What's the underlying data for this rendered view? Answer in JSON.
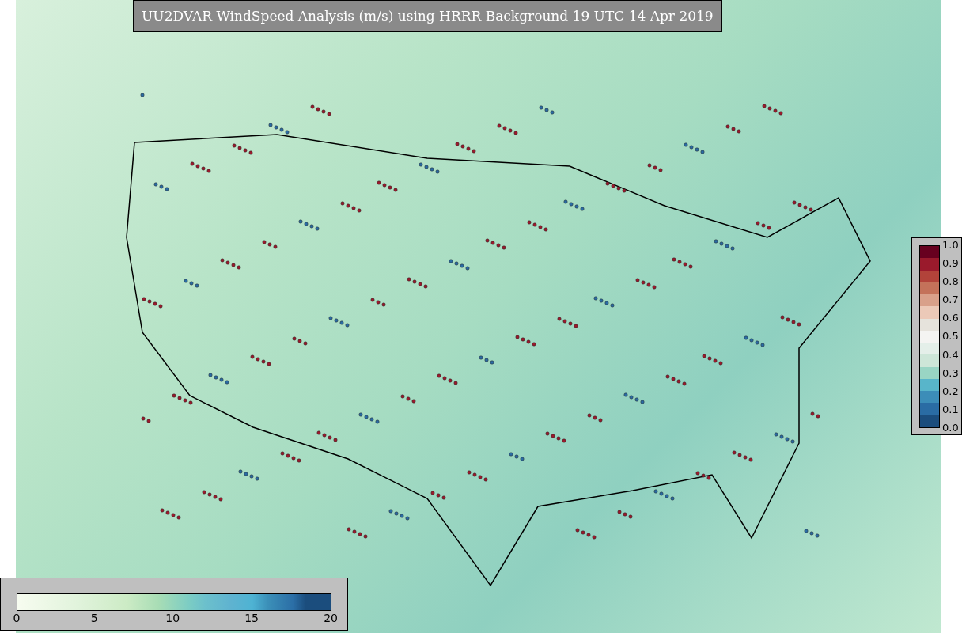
{
  "title": "UU2DVAR WindSpeed Analysis (m/s) using HRRR Background 19 UTC 14 Apr 2019",
  "right_colorbar": {
    "ticks": [
      "1.0",
      "0.9",
      "0.8",
      "0.7",
      "0.6",
      "0.5",
      "0.4",
      "0.3",
      "0.2",
      "0.1",
      "0.0"
    ]
  },
  "bottom_colorbar": {
    "ticks": [
      "0",
      "5",
      "10",
      "15",
      "20"
    ]
  }
}
